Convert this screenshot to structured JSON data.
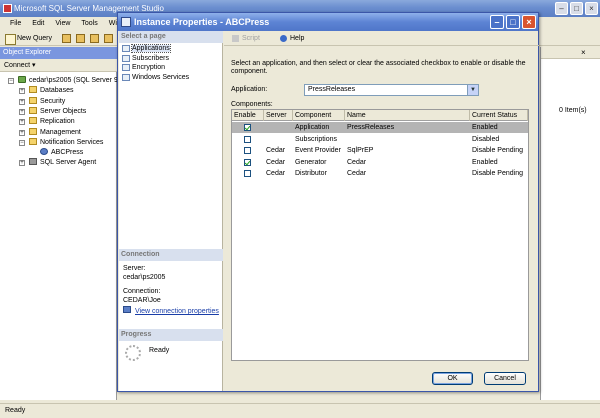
{
  "main": {
    "title": "Microsoft SQL Server Management Studio",
    "menu": [
      "File",
      "Edit",
      "View",
      "Tools",
      "Windo"
    ],
    "new_query": "New Query",
    "object_explorer": {
      "title": "Object Explorer",
      "connect": "Connect ▾",
      "tree": [
        {
          "label": "cedar\\ps2005 (SQL Server 9.0",
          "icon": "server-icon",
          "depth": 0,
          "expander": "–"
        },
        {
          "label": "Databases",
          "icon": "folder-icon",
          "depth": 1,
          "expander": "+"
        },
        {
          "label": "Security",
          "icon": "folder-icon",
          "depth": 1,
          "expander": "+"
        },
        {
          "label": "Server Objects",
          "icon": "folder-icon",
          "depth": 1,
          "expander": "+"
        },
        {
          "label": "Replication",
          "icon": "folder-icon",
          "depth": 1,
          "expander": "+"
        },
        {
          "label": "Management",
          "icon": "folder-icon",
          "depth": 1,
          "expander": "+"
        },
        {
          "label": "Notification Services",
          "icon": "folder-icon",
          "depth": 1,
          "expander": "–"
        },
        {
          "label": "ABCPress",
          "icon": "notification-icon",
          "depth": 2,
          "expander": ""
        },
        {
          "label": "SQL Server Agent",
          "icon": "agent-icon",
          "depth": 1,
          "expander": "+"
        }
      ]
    },
    "items_count": "0 Item(s)",
    "status": "Ready"
  },
  "dialog": {
    "title": "Instance Properties - ABCPress",
    "select_page": "Select a page",
    "pages": [
      "Applications",
      "Subscribers",
      "Encryption",
      "Windows Services"
    ],
    "selected_page": 0,
    "connection": {
      "header": "Connection",
      "server_label": "Server:",
      "server_value": "cedar\\ps2005",
      "connection_label": "Connection:",
      "connection_value": "CEDAR\\Joe",
      "view_link": "View connection properties"
    },
    "progress": {
      "header": "Progress",
      "status": "Ready"
    },
    "toolbar": {
      "script": "Script",
      "help": "Help"
    },
    "description": "Select an application, and then select or clear the associated checkbox to enable or disable the component.",
    "application_label": "Application:",
    "application_value": "PressReleases",
    "components_label": "Components:",
    "columns": [
      "Enable",
      "Server",
      "Component",
      "Name",
      "Current Status"
    ],
    "rows": [
      {
        "enabled": true,
        "server": "",
        "component": "Application",
        "name": "PressReleases",
        "status": "Enabled",
        "selected": true
      },
      {
        "enabled": false,
        "server": "",
        "component": "Subscriptions",
        "name": "",
        "status": "Disabled",
        "selected": false
      },
      {
        "enabled": false,
        "server": "Cedar",
        "component": "Event Provider",
        "name": "SqlPrEP",
        "status": "Disable Pending",
        "selected": false
      },
      {
        "enabled": true,
        "server": "Cedar",
        "component": "Generator",
        "name": "Cedar",
        "status": "Enabled",
        "selected": false
      },
      {
        "enabled": false,
        "server": "Cedar",
        "component": "Distributor",
        "name": "Cedar",
        "status": "Disable Pending",
        "selected": false
      }
    ],
    "ok": "OK",
    "cancel": "Cancel"
  }
}
